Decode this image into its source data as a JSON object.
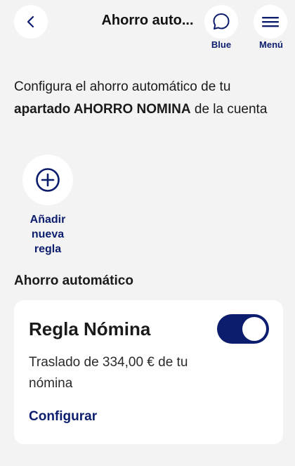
{
  "header": {
    "title": "Ahorro auto...",
    "back_icon": "chevron-left-icon",
    "chat_icon": "chat-bubble-icon",
    "chat_label": "Blue",
    "menu_icon": "hamburger-menu-icon",
    "menu_label": "Menú"
  },
  "intro": {
    "text_before": "Configura el ahorro automático de tu ",
    "bold_text": "apartado AHORRO NOMINA",
    "text_after": " de la cuenta"
  },
  "add_rule": {
    "icon": "plus-circle-icon",
    "label_lines": [
      "Añadir",
      "nueva",
      "regla"
    ]
  },
  "section": {
    "title": "Ahorro automático"
  },
  "rule_card": {
    "title": "Regla Nómina",
    "toggle_on": true,
    "description": "Traslado de 334,00 € de tu nómina",
    "action_label": "Configurar"
  },
  "colors": {
    "background": "#f3f3f4",
    "brand": "#0c1d6e",
    "card": "#ffffff"
  }
}
